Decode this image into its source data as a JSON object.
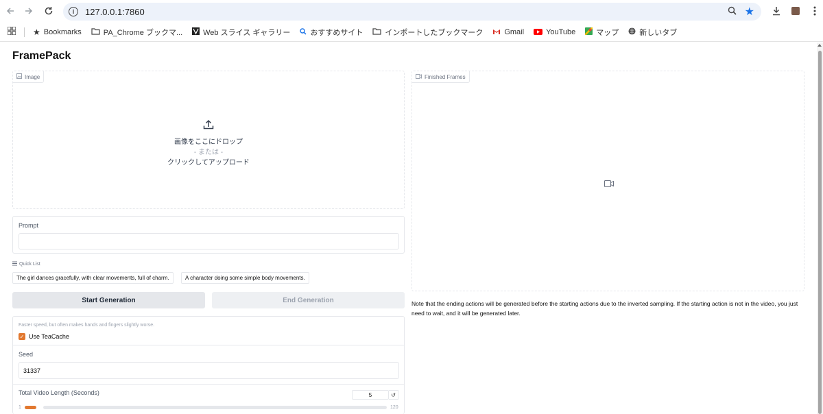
{
  "browser": {
    "url": "127.0.0.1:7860",
    "bookmarks": [
      {
        "label": "Bookmarks",
        "icon": "star-icon"
      },
      {
        "label": "PA_Chrome ブックマ...",
        "icon": "folder-icon"
      },
      {
        "label": "Web スライス ギャラリー",
        "icon": "web-slice-icon"
      },
      {
        "label": "おすすめサイト",
        "icon": "search-icon"
      },
      {
        "label": "インポートしたブックマーク",
        "icon": "folder-icon"
      },
      {
        "label": "Gmail",
        "icon": "gmail-icon"
      },
      {
        "label": "YouTube",
        "icon": "youtube-icon"
      },
      {
        "label": "マップ",
        "icon": "maps-icon"
      },
      {
        "label": "新しいタブ",
        "icon": "globe-icon"
      }
    ]
  },
  "app": {
    "title": "FramePack",
    "image_panel": {
      "tag": "Image",
      "drop_text": "画像をここにドロップ",
      "or_text": "- または -",
      "click_text": "クリックしてアップロード"
    },
    "prompt": {
      "label": "Prompt",
      "value": ""
    },
    "quick_list": {
      "label": "Quick List",
      "items": [
        "The girl dances gracefully, with clear movements, full of charm.",
        "A character doing some simple body movements."
      ]
    },
    "buttons": {
      "start": "Start Generation",
      "end": "End Generation"
    },
    "settings": {
      "teacache_hint": "Faster speed, but often makes hands and fingers slightly worse.",
      "teacache_label": "Use TeaCache",
      "teacache_checked": true,
      "seed_label": "Seed",
      "seed_value": "31337",
      "length_label": "Total Video Length (Seconds)",
      "length_value": "5",
      "length_min": "1",
      "length_max": "120"
    },
    "video_panel": {
      "tag": "Finished Frames"
    },
    "note": "Note that the ending actions will be generated before the starting actions due to the inverted sampling. If the starting action is not in the video, you just need to wait, and it will be generated later."
  },
  "colors": {
    "accent": "#e2782f",
    "omnibox": "#edf2fa",
    "star": "#1a73e8"
  }
}
